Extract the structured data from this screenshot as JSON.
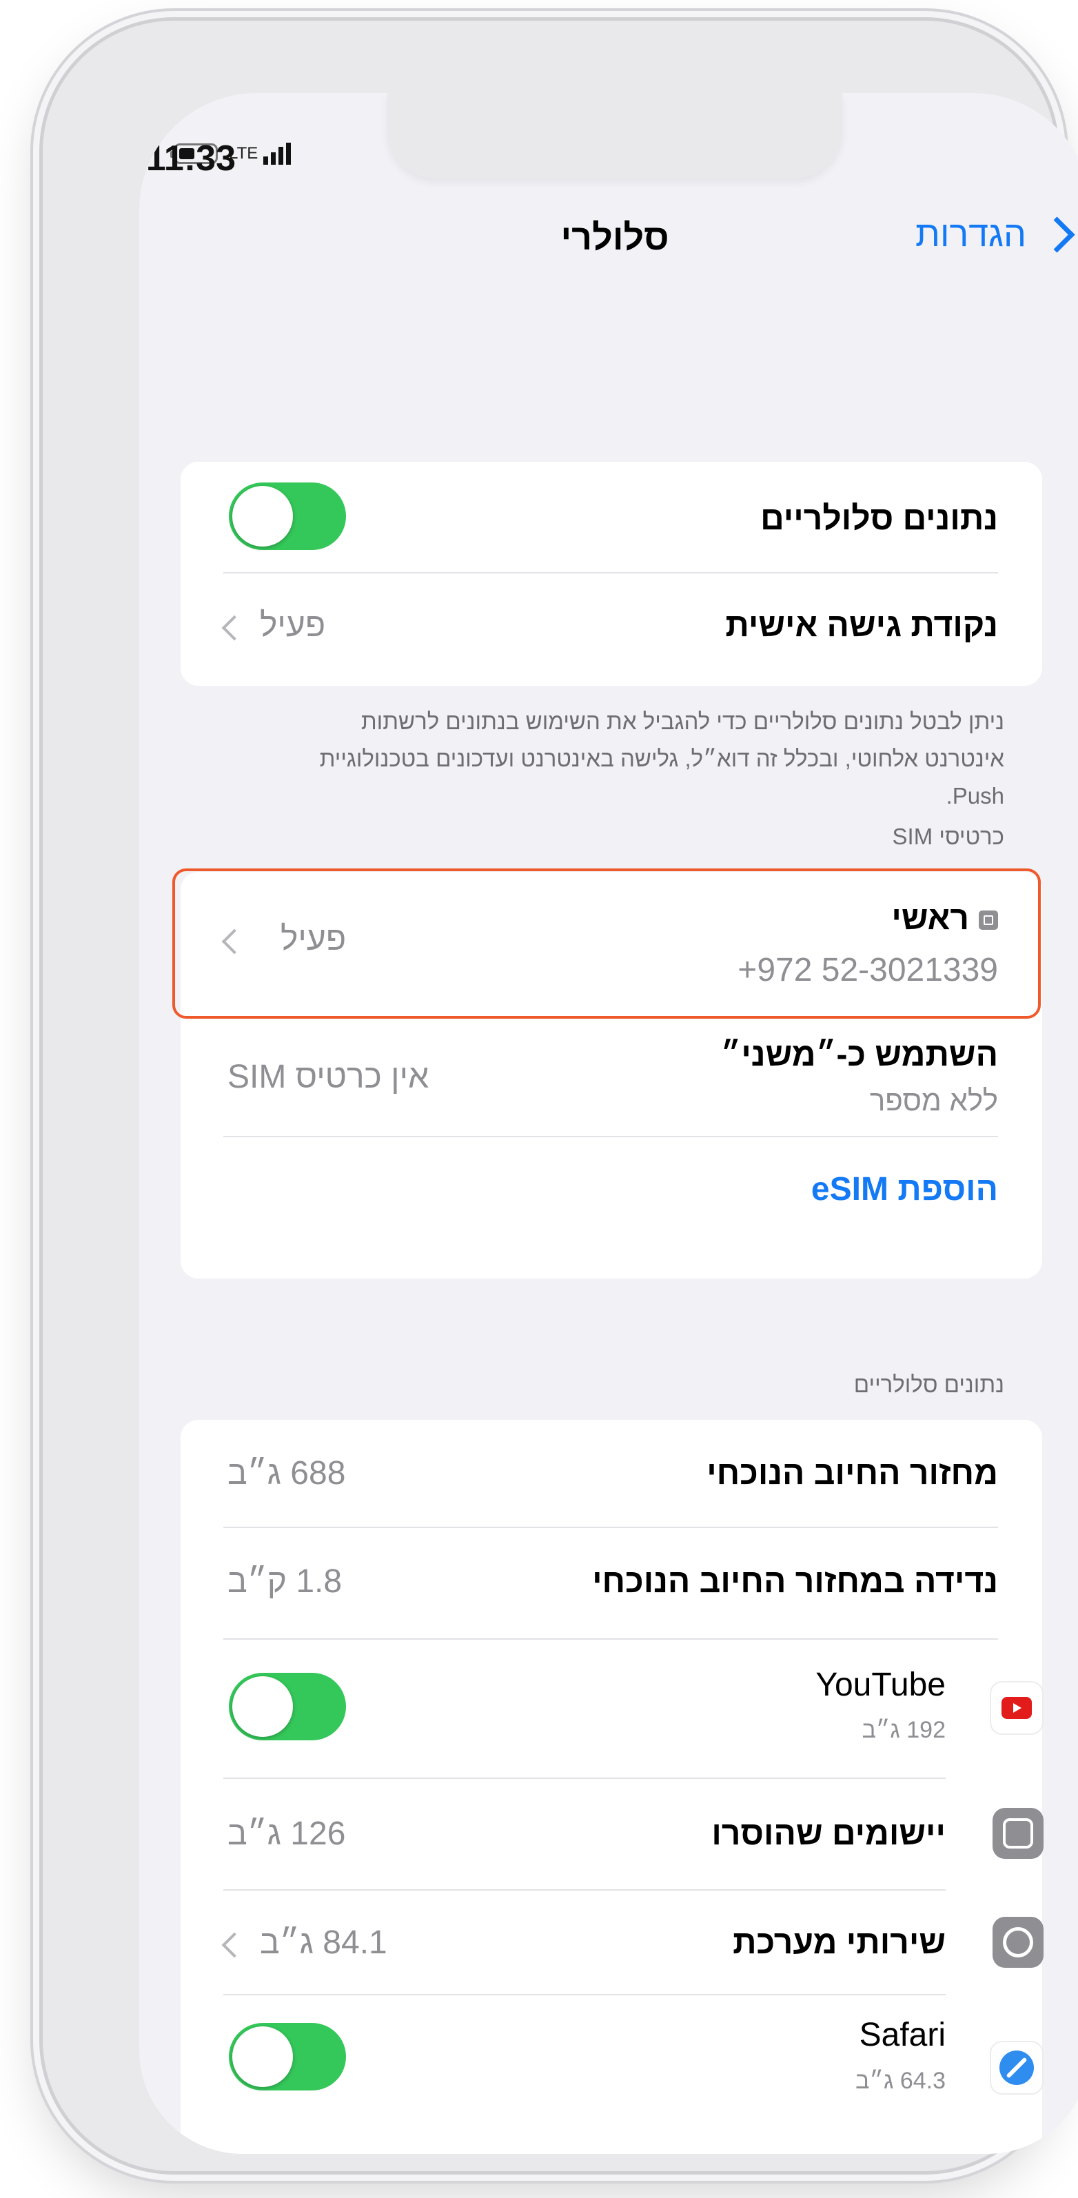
{
  "status_bar": {
    "time": "11:33",
    "network": "LTE"
  },
  "nav": {
    "title": "סלולרי",
    "back_label": "הגדרות"
  },
  "cellular_group": {
    "cellular_data_label": "נתונים סלולריים",
    "hotspot_label": "נקודת גישה אישית",
    "hotspot_value": "פעיל"
  },
  "cellular_footnote": "ניתן לבטל נתונים סלולריים כדי להגביל את השימוש בנתונים לרשתות אינטרנט אלחוטי, ובכלל זה דוא״ל, גלישה באינטרנט ועדכונים בטכנולוגיית Push.",
  "sim_section": {
    "header": "כרטיסי SIM",
    "primary_label": "ראשי",
    "primary_number": "+972 52-3021339",
    "primary_value": "פעיל",
    "secondary_label": "השתמש כ-״משני״",
    "secondary_sub": "ללא מספר",
    "secondary_value": "אין כרטיס SIM",
    "add_esim": "הוספת eSIM"
  },
  "usage_section": {
    "header": "נתונים סלולריים",
    "current_period_label": "מחזור החיוב הנוכחי",
    "current_period_value": "688 ג״ב",
    "roaming_label": "נדידה במחזור החיוב הנוכחי",
    "roaming_value": "1.8 ק״ב",
    "apps": [
      {
        "name": "YouTube",
        "usage": "192 ג״ב",
        "icon": "youtube-icon"
      },
      {
        "name": "יישומים שהוסרו",
        "usage": "126 ג״ב",
        "icon": "app-store-icon"
      },
      {
        "name": "שירותי מערכת",
        "usage": "84.1 ג״ב",
        "icon": "settings-gear-icon"
      },
      {
        "name": "Safari",
        "usage": "64.3 ג״ב",
        "icon": "safari-icon"
      }
    ]
  },
  "colors": {
    "accent": "#1479f5",
    "toggle_on": "#34c759",
    "highlight": "#ee5a2c"
  }
}
